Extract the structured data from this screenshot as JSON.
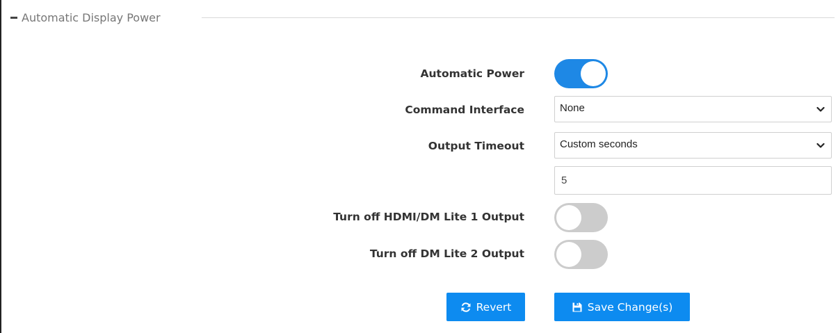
{
  "section": {
    "title": "Automatic Display Power",
    "collapse_icon": "minus-icon"
  },
  "form": {
    "automatic_power": {
      "label": "Automatic Power",
      "enabled": true
    },
    "command_interface": {
      "label": "Command Interface",
      "selected": "None"
    },
    "output_timeout": {
      "label": "Output Timeout",
      "selected": "Custom seconds",
      "custom_value": "5"
    },
    "turn_off_hdmi_dm_lite_1": {
      "label": "Turn off HDMI/DM Lite 1 Output",
      "enabled": false
    },
    "turn_off_dm_lite_2": {
      "label": "Turn off DM Lite 2 Output",
      "enabled": false
    }
  },
  "actions": {
    "revert_label": "Revert",
    "revert_icon": "refresh-icon",
    "save_label": "Save Change(s)",
    "save_icon": "floppy-disk-icon"
  },
  "colors": {
    "accent": "#1e88e5",
    "button": "#0d8bf0",
    "toggle_off": "#cccccc"
  }
}
